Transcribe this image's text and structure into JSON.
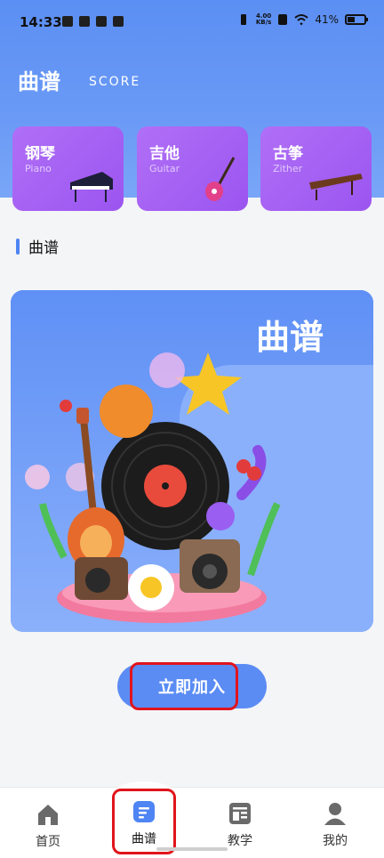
{
  "status_bar": {
    "time": "14:33",
    "net_speed_value": "4.00",
    "net_speed_unit": "KB/s",
    "battery": "41%"
  },
  "header": {
    "title": "曲谱",
    "subtitle": "SCORE"
  },
  "instruments": [
    {
      "name": "钢琴",
      "english": "Piano",
      "icon": "piano-icon"
    },
    {
      "name": "吉他",
      "english": "Guitar",
      "icon": "guitar-icon"
    },
    {
      "name": "古筝",
      "english": "Zither",
      "icon": "zither-icon"
    }
  ],
  "section": {
    "label": "曲谱"
  },
  "hero": {
    "title": "曲谱"
  },
  "join_button": {
    "label": "立即加入"
  },
  "tabs": [
    {
      "label": "首页",
      "icon": "home-icon"
    },
    {
      "label": "曲谱",
      "icon": "score-icon",
      "active": true
    },
    {
      "label": "教学",
      "icon": "teaching-icon"
    },
    {
      "label": "我的",
      "icon": "user-icon"
    }
  ],
  "colors": {
    "primary": "#5b8cf4",
    "card_purple": "#a563f4",
    "highlight_red": "#e1141c"
  }
}
